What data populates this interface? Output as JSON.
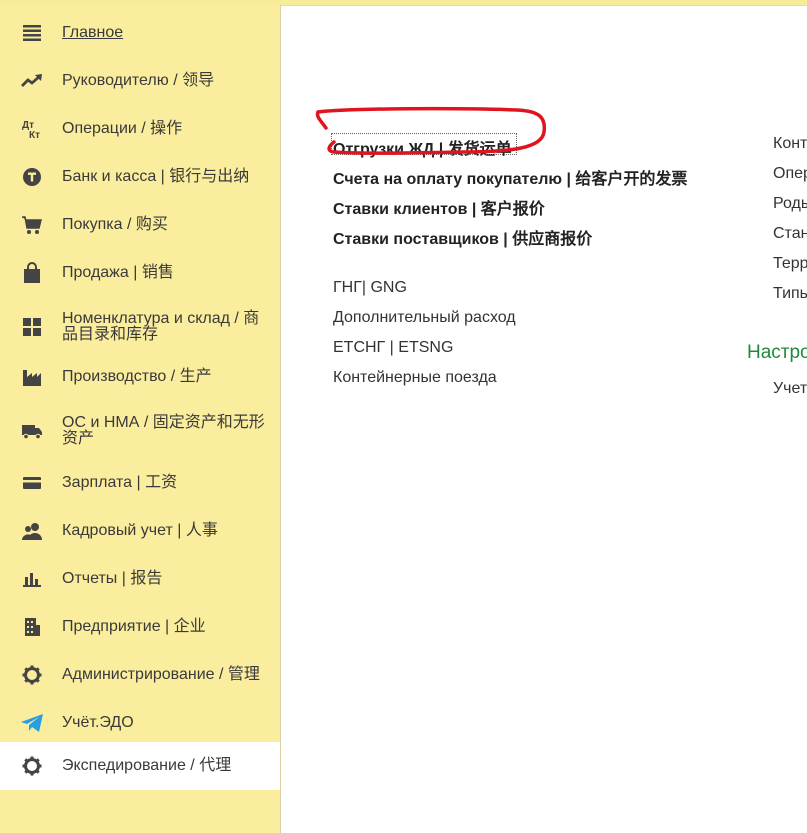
{
  "sidebar": {
    "items": [
      {
        "label": "Главное",
        "icon": "hamburger-menu-icon"
      },
      {
        "label": "Руководителю / 领导",
        "icon": "trend-up-icon"
      },
      {
        "label": "Операции / 操作",
        "icon": "debit-credit-icon"
      },
      {
        "label": "Банк и касса | 银行与出纳",
        "icon": "coin-icon"
      },
      {
        "label": "Покупка / 购买",
        "icon": "shopping-cart-icon"
      },
      {
        "label": "Продажа | 销售",
        "icon": "shopping-bag-icon"
      },
      {
        "label": "Номенклатура и склад / 商品目录和库存",
        "icon": "warehouse-grid-icon"
      },
      {
        "label": "Производство / 生产",
        "icon": "factory-icon"
      },
      {
        "label": "ОС и НМА / 固定资产和无形资产",
        "icon": "truck-icon"
      },
      {
        "label": "Зарплата | 工资",
        "icon": "wallet-card-icon"
      },
      {
        "label": "Кадровый учет | 人事",
        "icon": "people-icon"
      },
      {
        "label": "Отчеты | 报告",
        "icon": "bar-chart-icon"
      },
      {
        "label": "Предприятие | 企业",
        "icon": "building-icon"
      },
      {
        "label": "Администрирование / 管理",
        "icon": "gear-icon"
      },
      {
        "label": "Учёт.ЭДО",
        "icon": "telegram-plane-icon"
      },
      {
        "label": "Экспедирование / 代理",
        "icon": "gear-icon"
      }
    ],
    "active_index": 15
  },
  "main": {
    "primary_links": [
      "Отгрузки ЖД | 发货运单",
      "Счета на оплату покупателю | 给客户开的发票",
      "Ставки клиентов | 客户报价",
      "Ставки поставщиков | 供应商报价"
    ],
    "secondary_links": [
      "ГНГ| GNG",
      "Дополнительный расход",
      "ЕТСНГ | ETSNG",
      "Контейнерные поезда"
    ],
    "right_links": [
      "Контр",
      "Опер",
      "Роды",
      "Стан",
      "Терр",
      "Типь"
    ],
    "settings_title": "Настро",
    "settings_links": [
      "Учет"
    ]
  },
  "colors": {
    "sidebar_bg": "#fbed9e",
    "active_bg": "#ffffff",
    "section_title": "#1f8a3c",
    "annotation_stroke": "#e0141e"
  }
}
